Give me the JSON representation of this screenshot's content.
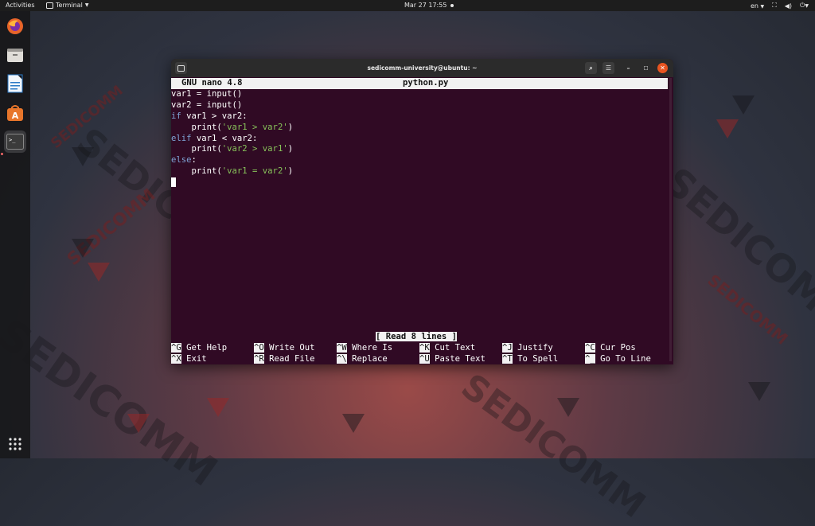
{
  "topbar": {
    "activities": "Activities",
    "app_name": "Terminal",
    "clock": "Mar 27  17:55",
    "lang": "en"
  },
  "wallpaper": {
    "brand_text": "SEDICOMM"
  },
  "dock": {
    "items": [
      "firefox-icon",
      "files-icon",
      "writer-icon",
      "software-icon",
      "terminal-icon"
    ],
    "apps_grid": "show-applications-icon"
  },
  "window": {
    "title": "sedicomm-university@ubuntu: ~",
    "nano": {
      "version": "GNU nano 4.8",
      "filename": "python.py"
    },
    "code": [
      {
        "parts": [
          {
            "t": "var1 = input()",
            "c": "plain"
          }
        ]
      },
      {
        "parts": [
          {
            "t": "var2 = input()",
            "c": "plain"
          }
        ]
      },
      {
        "parts": [
          {
            "t": "if",
            "c": "kw"
          },
          {
            "t": " var1 > var2:",
            "c": "plain"
          }
        ]
      },
      {
        "parts": [
          {
            "t": "    print(",
            "c": "plain"
          },
          {
            "t": "'var1 > var2'",
            "c": "str"
          },
          {
            "t": ")",
            "c": "plain"
          }
        ]
      },
      {
        "parts": [
          {
            "t": "elif",
            "c": "kw"
          },
          {
            "t": " var1 < var2:",
            "c": "plain"
          }
        ]
      },
      {
        "parts": [
          {
            "t": "    print(",
            "c": "plain"
          },
          {
            "t": "'var2 > var1'",
            "c": "str"
          },
          {
            "t": ")",
            "c": "plain"
          }
        ]
      },
      {
        "parts": [
          {
            "t": "else",
            "c": "kw"
          },
          {
            "t": ":",
            "c": "plain"
          }
        ]
      },
      {
        "parts": [
          {
            "t": "    print(",
            "c": "plain"
          },
          {
            "t": "'var1 = var2'",
            "c": "str"
          },
          {
            "t": ")",
            "c": "plain"
          }
        ]
      }
    ],
    "status": "[ Read 8 lines ]",
    "shortcuts": [
      {
        "key": "^G",
        "label": "Get Help"
      },
      {
        "key": "^X",
        "label": "Exit"
      },
      {
        "key": "^O",
        "label": "Write Out"
      },
      {
        "key": "^R",
        "label": "Read File"
      },
      {
        "key": "^W",
        "label": "Where Is"
      },
      {
        "key": "^\\",
        "label": "Replace"
      },
      {
        "key": "^K",
        "label": "Cut Text"
      },
      {
        "key": "^U",
        "label": "Paste Text"
      },
      {
        "key": "^J",
        "label": "Justify"
      },
      {
        "key": "^T",
        "label": "To Spell"
      },
      {
        "key": "^C",
        "label": "Cur Pos"
      },
      {
        "key": "^_",
        "label": "Go To Line"
      }
    ]
  },
  "colors": {
    "terminal_bg": "#300a24",
    "keyword": "#7fa4d6",
    "string": "#87c25a"
  }
}
